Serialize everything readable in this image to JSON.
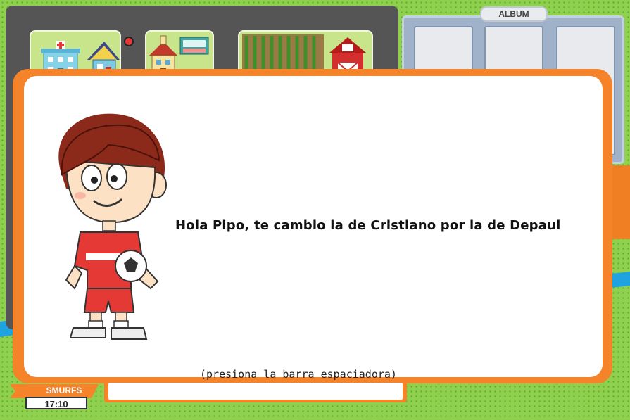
{
  "album": {
    "tab_label": "ALBUM"
  },
  "dialog": {
    "speaker_character": "soccer-boy",
    "message": "Hola Pipo, te cambio la de Cristiano por la de Depaul",
    "hint": "(presiona la barra espaciadora)"
  },
  "hud": {
    "player_name": "SMURFS",
    "clock": "17:10"
  },
  "colors": {
    "grass": "#8fd14f",
    "dialog_frame": "#f5832a",
    "map_panel": "#555555",
    "album_panel": "#9fb2c9"
  },
  "map_locations": [
    {
      "name": "hospital-and-house"
    },
    {
      "name": "school-and-shop"
    },
    {
      "name": "farm-and-barn"
    }
  ]
}
